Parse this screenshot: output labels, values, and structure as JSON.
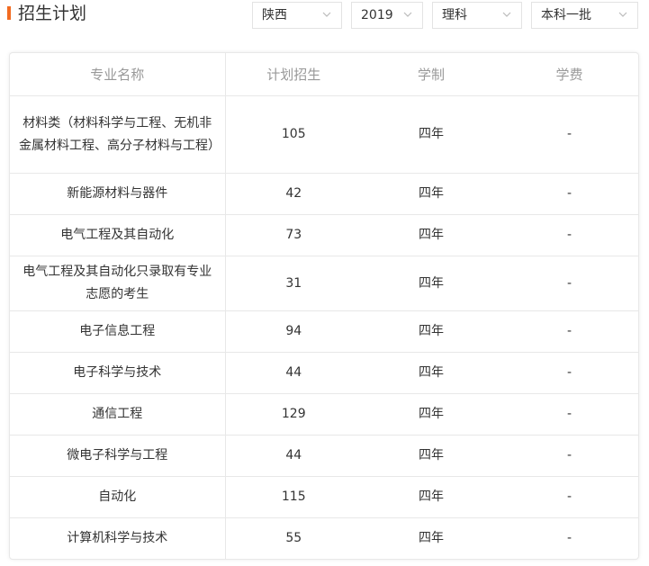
{
  "header": {
    "title": "招生计划"
  },
  "filters": {
    "province": "陕西",
    "year": "2019",
    "category": "理科",
    "batch": "本科一批"
  },
  "table": {
    "columns": [
      "专业名称",
      "计划招生",
      "学制",
      "学费"
    ],
    "rows": [
      {
        "name": "材料类（材料科学与工程、无机非金属材料工程、高分子材料与工程）",
        "plan": "105",
        "years": "四年",
        "fee": "-"
      },
      {
        "name": "新能源材料与器件",
        "plan": "42",
        "years": "四年",
        "fee": "-"
      },
      {
        "name": "电气工程及其自动化",
        "plan": "73",
        "years": "四年",
        "fee": "-"
      },
      {
        "name": "电气工程及其自动化只录取有专业志愿的考生",
        "plan": "31",
        "years": "四年",
        "fee": "-"
      },
      {
        "name": "电子信息工程",
        "plan": "94",
        "years": "四年",
        "fee": "-"
      },
      {
        "name": "电子科学与技术",
        "plan": "44",
        "years": "四年",
        "fee": "-"
      },
      {
        "name": "通信工程",
        "plan": "129",
        "years": "四年",
        "fee": "-"
      },
      {
        "name": "微电子科学与工程",
        "plan": "44",
        "years": "四年",
        "fee": "-"
      },
      {
        "name": "自动化",
        "plan": "115",
        "years": "四年",
        "fee": "-"
      },
      {
        "name": "计算机科学与技术",
        "plan": "55",
        "years": "四年",
        "fee": "-"
      }
    ]
  },
  "colors": {
    "accent": "#f26b21",
    "header_text": "#999999",
    "body_text": "#333333",
    "border": "#e8e8e8"
  },
  "icons": {
    "dropdown": "chevron-down-icon",
    "title_marker": "accent-bar"
  }
}
